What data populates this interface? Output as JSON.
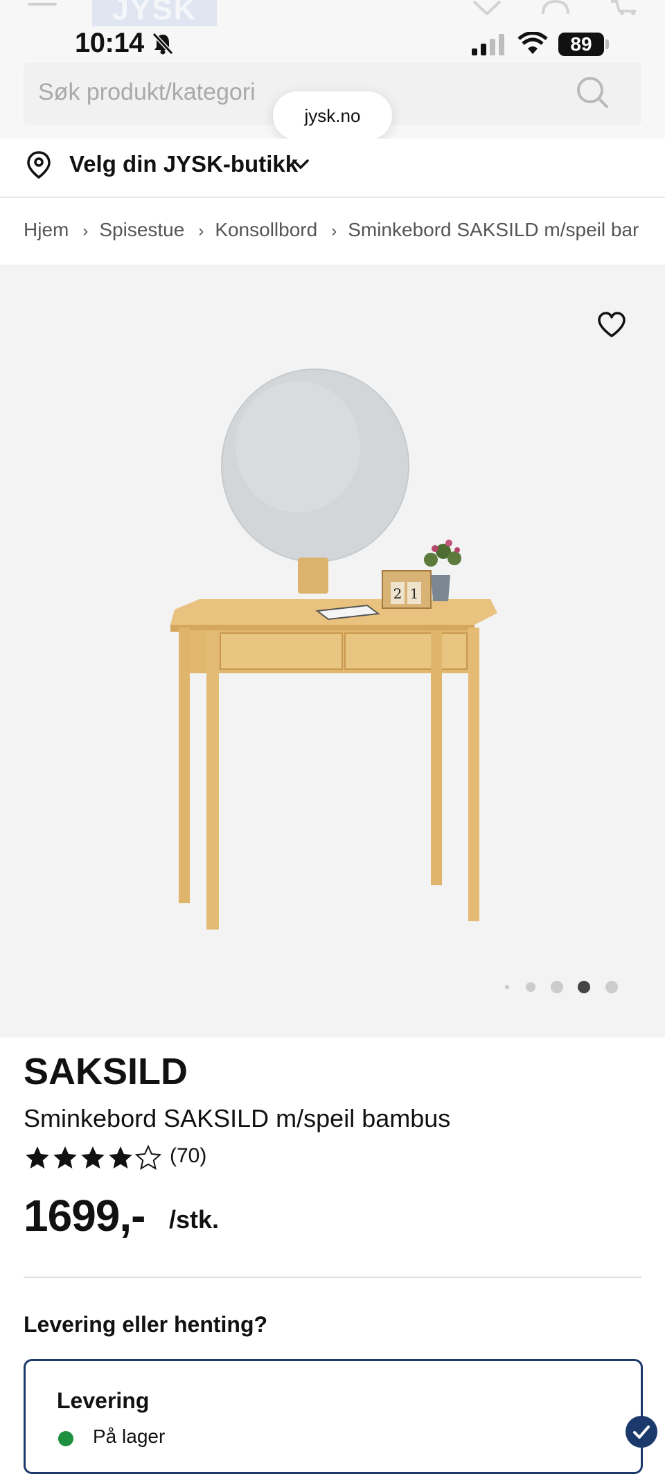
{
  "status_bar": {
    "time": "10:14",
    "battery": "89"
  },
  "header": {
    "logo_text": "JYSK"
  },
  "search": {
    "placeholder": "Søk produkt/kategori"
  },
  "browser": {
    "url": "jysk.no"
  },
  "store": {
    "label": "Velg din JYSK-butikk"
  },
  "breadcrumb": [
    "Hjem",
    "Spisestue",
    "Konsollbord",
    "Sminkebord SAKSILD m/speil bar"
  ],
  "gallery": {
    "dot_count": 5,
    "active_dot": 4
  },
  "product": {
    "brand": "SAKSILD",
    "name": "Sminkebord SAKSILD m/speil bambus",
    "rating": 4,
    "rating_max": 5,
    "reviews": "(70)",
    "price": "1699,-",
    "unit": "/stk."
  },
  "delivery": {
    "heading": "Levering eller henting?",
    "option_title": "Levering",
    "stock_status": "På lager"
  },
  "colors": {
    "accent_navy": "#1b3a6b",
    "in_stock_green": "#1e8f3e",
    "gallery_bg": "#f3f3f4"
  }
}
